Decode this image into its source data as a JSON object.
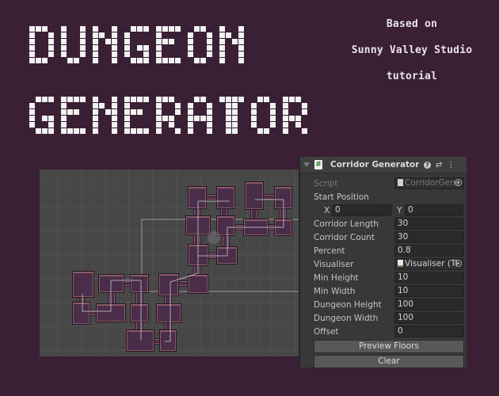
{
  "title": {
    "lines": [
      "DUNGEON",
      "GENERATOR"
    ]
  },
  "subtitle": {
    "line1": "Based on",
    "line2": "Sunny Valley Studio",
    "line3": "tutorial"
  },
  "colors": {
    "background": "#3a2034",
    "scene_bg": "#474747",
    "room_fill": "#4a2d49",
    "room_edge": "#8a5a68",
    "gizmo_line": "#c8c8d0",
    "title_block": "#f2f2f2"
  },
  "scene": {
    "rooms": [
      [
        238,
        236,
        22,
        27
      ],
      [
        274,
        236,
        22,
        27
      ],
      [
        310,
        230,
        22,
        34
      ],
      [
        347,
        236,
        21,
        27
      ],
      [
        235,
        273,
        30,
        23
      ],
      [
        274,
        273,
        22,
        24
      ],
      [
        308,
        277,
        30,
        20
      ],
      [
        347,
        277,
        21,
        20
      ],
      [
        238,
        309,
        24,
        26
      ],
      [
        274,
        312,
        25,
        21
      ],
      [
        238,
        347,
        24,
        23
      ],
      [
        201,
        346,
        24,
        27
      ],
      [
        92,
        343,
        26,
        32
      ],
      [
        125,
        347,
        31,
        22
      ],
      [
        165,
        347,
        22,
        22
      ],
      [
        92,
        382,
        21,
        27
      ],
      [
        122,
        384,
        36,
        22
      ],
      [
        165,
        384,
        22,
        22
      ],
      [
        198,
        384,
        30,
        23
      ],
      [
        160,
        417,
        34,
        26
      ],
      [
        202,
        417,
        20,
        26
      ]
    ],
    "corridors": [
      [
        260,
        246,
        14,
        6
      ],
      [
        332,
        246,
        15,
        6
      ],
      [
        245,
        263,
        8,
        10
      ],
      [
        279,
        263,
        8,
        10
      ],
      [
        317,
        264,
        8,
        13
      ],
      [
        353,
        263,
        8,
        14
      ],
      [
        296,
        284,
        12,
        6
      ],
      [
        338,
        284,
        9,
        6
      ],
      [
        245,
        296,
        8,
        13
      ],
      [
        281,
        297,
        8,
        15
      ],
      [
        262,
        320,
        12,
        6
      ],
      [
        245,
        335,
        8,
        12
      ],
      [
        225,
        355,
        13,
        6
      ],
      [
        156,
        355,
        9,
        6
      ],
      [
        98,
        375,
        8,
        7
      ],
      [
        113,
        392,
        9,
        6
      ],
      [
        137,
        369,
        8,
        15
      ],
      [
        172,
        369,
        8,
        15
      ],
      [
        208,
        373,
        8,
        11
      ],
      [
        172,
        406,
        8,
        11
      ],
      [
        208,
        407,
        8,
        10
      ],
      [
        194,
        428,
        8,
        6
      ]
    ],
    "paths": [
      [
        [
          250,
          254
        ],
        [
          250,
          345
        ],
        [
          215,
          356
        ],
        [
          215,
          431
        ],
        [
          208,
          431
        ]
      ],
      [
        [
          250,
          254
        ],
        [
          290,
          254
        ]
      ],
      [
        [
          322,
          252
        ],
        [
          358,
          252
        ],
        [
          358,
          287
        ],
        [
          287,
          287
        ],
        [
          287,
          323
        ],
        [
          250,
          323
        ]
      ],
      [
        [
          178,
          354
        ],
        [
          178,
          430
        ]
      ],
      [
        [
          140,
          354
        ],
        [
          178,
          354
        ]
      ],
      [
        [
          140,
          354
        ],
        [
          140,
          393
        ],
        [
          104,
          393
        ],
        [
          104,
          371
        ]
      ]
    ]
  },
  "inspector": {
    "header": {
      "title": "Corridor Generator (S",
      "script_icon": "#",
      "help_icon": "?",
      "presets_icon": "sliders",
      "menu_icon": "kebab-menu"
    },
    "script": {
      "label": "Script",
      "value": "CorridorGene"
    },
    "start_position": {
      "label": "Start Position",
      "x_label": "X",
      "x": "0",
      "y_label": "Y",
      "y": "0"
    },
    "fields": [
      {
        "label": "Corridor Length",
        "value": "30"
      },
      {
        "label": "Corridor Count",
        "value": "30"
      },
      {
        "label": "Percent",
        "value": "0.8"
      }
    ],
    "visualiser": {
      "label": "Visualiser",
      "value": "Visualiser (Ti"
    },
    "fields2": [
      {
        "label": "Min Height",
        "value": "10"
      },
      {
        "label": "Min Width",
        "value": "10"
      },
      {
        "label": "Dungeon Height",
        "value": "100"
      },
      {
        "label": "Dungeon Width",
        "value": "100"
      },
      {
        "label": "Offset",
        "value": "0"
      }
    ],
    "buttons": {
      "preview": "Preview Floors",
      "clear": "Clear"
    }
  }
}
